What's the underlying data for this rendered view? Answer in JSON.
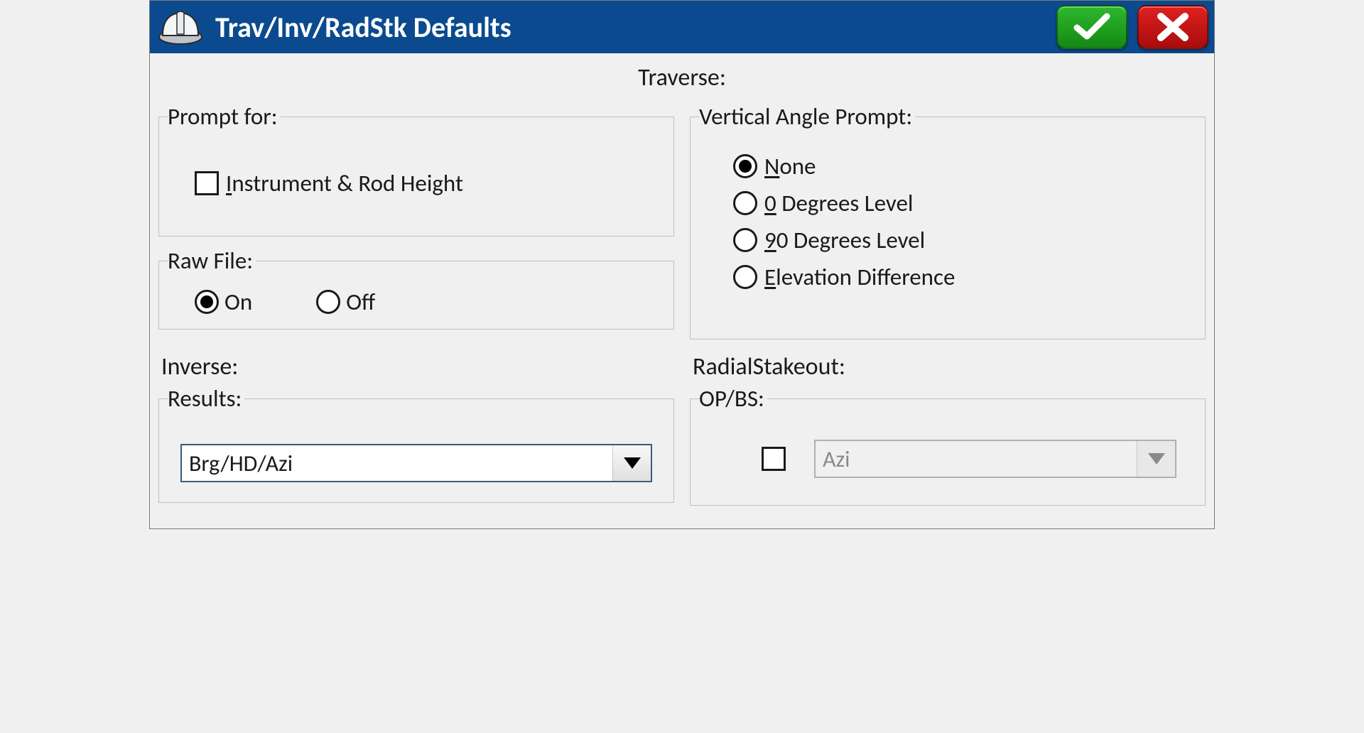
{
  "titlebar": {
    "title": "Trav/Inv/RadStk Defaults"
  },
  "traverse": {
    "heading": "Traverse:",
    "prompt_for": {
      "legend": "Prompt for:",
      "instrument_rod": {
        "label": "Instrument & Rod Height",
        "underline": "I",
        "checked": false
      }
    },
    "raw_file": {
      "legend": "Raw File:",
      "on": "On",
      "off": "Off",
      "selected": "on"
    },
    "vap": {
      "legend": "Vertical Angle Prompt:",
      "options": [
        {
          "label": "None",
          "underline": "N",
          "value": "none"
        },
        {
          "label": "0 Degrees Level",
          "underline": "0",
          "value": "0deg"
        },
        {
          "label": "90 Degrees Level",
          "underline": "9",
          "value": "90deg"
        },
        {
          "label": "Elevation Difference",
          "underline": "E",
          "value": "elev"
        }
      ],
      "selected": "none"
    }
  },
  "inverse": {
    "heading": "Inverse:",
    "results": {
      "legend": "Results:",
      "value": "Brg/HD/Azi"
    }
  },
  "radstk": {
    "heading": "RadialStakeout:",
    "opbs": {
      "legend": "OP/BS:",
      "checked": false,
      "value": "Azi",
      "enabled": false
    }
  }
}
